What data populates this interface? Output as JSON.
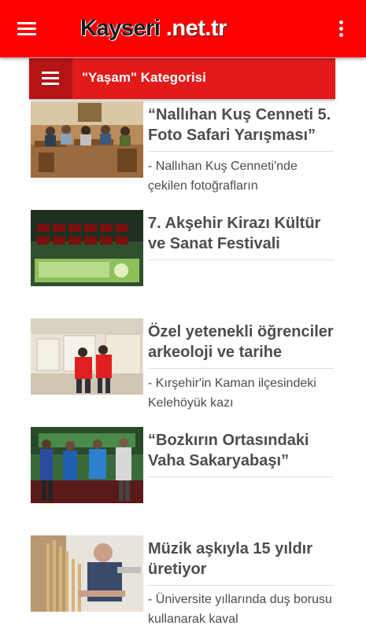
{
  "app": {
    "logo_main": "Kayseri",
    "logo_suffix": ".net.tr",
    "brand_color": "#ff0000"
  },
  "category": {
    "title": "\"Yaşam\" Kategorisi",
    "accent": "#e21a1a"
  },
  "articles": [
    {
      "title": "“Nallıhan Kuş Cenneti 5. Foto Safari Yarışması”",
      "excerpt": "- Nallıhan Kuş Cenneti'nde çekilen fotoğrafların"
    },
    {
      "title": "7. Akşehir Kirazı Kültür ve Sanat Festivali",
      "excerpt": ""
    },
    {
      "title": "Özel yetenekli öğrenciler arkeoloji ve tarihe",
      "excerpt": "- Kırşehir'in Kaman ilçesindeki Kelehöyük kazı"
    },
    {
      "title": "“Bozkırın Ortasındaki Vaha Sakaryabaşı”",
      "excerpt": ""
    },
    {
      "title": "Müzik aşkıyla 15 yıldır üretiyor",
      "excerpt": "- Üniversite yıllarında duş borusu kullanarak kaval"
    }
  ],
  "icons": {
    "nav": "hamburger-menu-icon",
    "overflow": "more-vertical-icon",
    "category_menu": "category-menu-icon"
  }
}
